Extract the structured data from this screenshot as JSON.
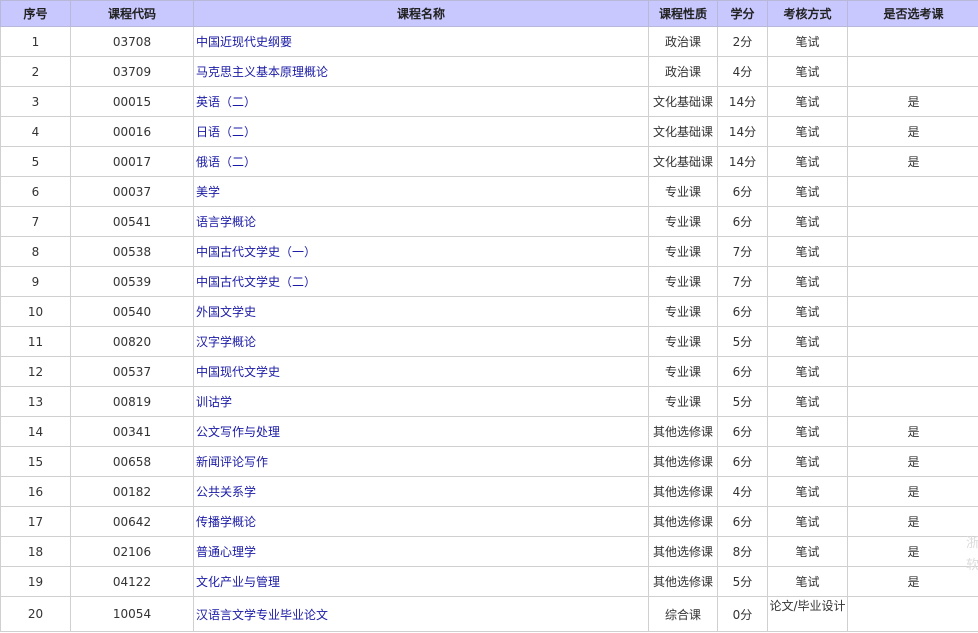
{
  "headers": [
    "序号",
    "课程代码",
    "课程名称",
    "课程性质",
    "学分",
    "考核方式",
    "是否选考课"
  ],
  "rows": [
    {
      "no": "1",
      "code": "03708",
      "name": "中国近现代史纲要",
      "type": "政治课",
      "credit": "2分",
      "method": "笔试",
      "elective": ""
    },
    {
      "no": "2",
      "code": "03709",
      "name": "马克思主义基本原理概论",
      "type": "政治课",
      "credit": "4分",
      "method": "笔试",
      "elective": ""
    },
    {
      "no": "3",
      "code": "00015",
      "name": "英语（二）",
      "type": "文化基础课",
      "credit": "14分",
      "method": "笔试",
      "elective": "是"
    },
    {
      "no": "4",
      "code": "00016",
      "name": "日语（二）",
      "type": "文化基础课",
      "credit": "14分",
      "method": "笔试",
      "elective": "是"
    },
    {
      "no": "5",
      "code": "00017",
      "name": "俄语（二）",
      "type": "文化基础课",
      "credit": "14分",
      "method": "笔试",
      "elective": "是"
    },
    {
      "no": "6",
      "code": "00037",
      "name": "美学",
      "type": "专业课",
      "credit": "6分",
      "method": "笔试",
      "elective": ""
    },
    {
      "no": "7",
      "code": "00541",
      "name": "语言学概论",
      "type": "专业课",
      "credit": "6分",
      "method": "笔试",
      "elective": ""
    },
    {
      "no": "8",
      "code": "00538",
      "name": "中国古代文学史（一）",
      "type": "专业课",
      "credit": "7分",
      "method": "笔试",
      "elective": ""
    },
    {
      "no": "9",
      "code": "00539",
      "name": "中国古代文学史（二）",
      "type": "专业课",
      "credit": "7分",
      "method": "笔试",
      "elective": ""
    },
    {
      "no": "10",
      "code": "00540",
      "name": "外国文学史",
      "type": "专业课",
      "credit": "6分",
      "method": "笔试",
      "elective": ""
    },
    {
      "no": "11",
      "code": "00820",
      "name": "汉字学概论",
      "type": "专业课",
      "credit": "5分",
      "method": "笔试",
      "elective": ""
    },
    {
      "no": "12",
      "code": "00537",
      "name": "中国现代文学史",
      "type": "专业课",
      "credit": "6分",
      "method": "笔试",
      "elective": ""
    },
    {
      "no": "13",
      "code": "00819",
      "name": "训诂学",
      "type": "专业课",
      "credit": "5分",
      "method": "笔试",
      "elective": ""
    },
    {
      "no": "14",
      "code": "00341",
      "name": "公文写作与处理",
      "type": "其他选修课",
      "credit": "6分",
      "method": "笔试",
      "elective": "是"
    },
    {
      "no": "15",
      "code": "00658",
      "name": "新闻评论写作",
      "type": "其他选修课",
      "credit": "6分",
      "method": "笔试",
      "elective": "是"
    },
    {
      "no": "16",
      "code": "00182",
      "name": "公共关系学",
      "type": "其他选修课",
      "credit": "4分",
      "method": "笔试",
      "elective": "是"
    },
    {
      "no": "17",
      "code": "00642",
      "name": "传播学概论",
      "type": "其他选修课",
      "credit": "6分",
      "method": "笔试",
      "elective": "是"
    },
    {
      "no": "18",
      "code": "02106",
      "name": "普通心理学",
      "type": "其他选修课",
      "credit": "8分",
      "method": "笔试",
      "elective": "是"
    },
    {
      "no": "19",
      "code": "04122",
      "name": "文化产业与管理",
      "type": "其他选修课",
      "credit": "5分",
      "method": "笔试",
      "elective": "是"
    },
    {
      "no": "20",
      "code": "10054",
      "name": "汉语言文学专业毕业论文",
      "type": "综合课",
      "credit": "0分",
      "method": "论文/毕业设计",
      "elective": ""
    }
  ],
  "watermark": "浙软"
}
